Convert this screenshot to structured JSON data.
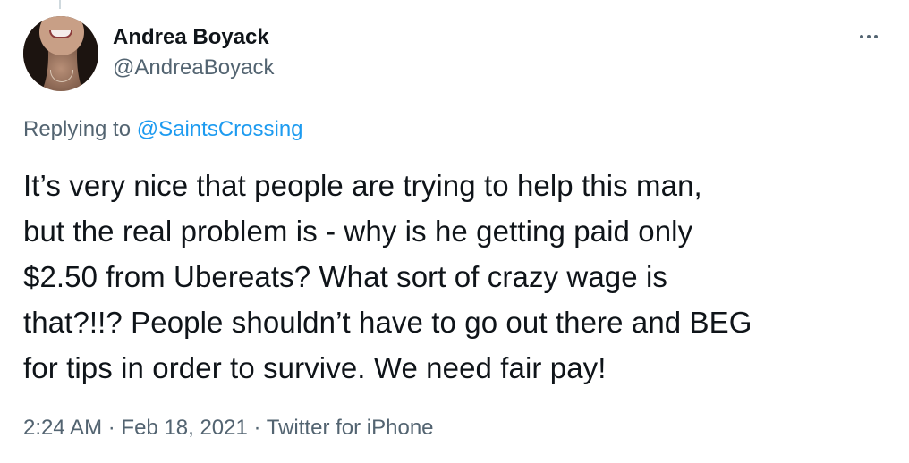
{
  "author": {
    "display_name": "Andrea Boyack",
    "handle": "@AndreaBoyack"
  },
  "reply": {
    "prefix": "Replying to",
    "to_handle": "@SaintsCrossing"
  },
  "tweet": {
    "lines": [
      "It’s very nice that people are trying to help this man,",
      "but the real problem is - why is he getting paid only",
      "$2.50 from Ubereats? What sort of crazy wage is",
      "that?!!? People shouldn’t have to go out there and BEG",
      "for tips in order to survive. We need fair pay!"
    ]
  },
  "meta": {
    "time": "2:24 AM",
    "separator": "·",
    "date": "Feb 18, 2021",
    "source": "Twitter for iPhone"
  },
  "icons": {
    "more": "more-horizontal-icon"
  },
  "colors": {
    "link": "#1d9bf0",
    "secondary_text": "#536471",
    "primary_text": "#0f1419"
  }
}
